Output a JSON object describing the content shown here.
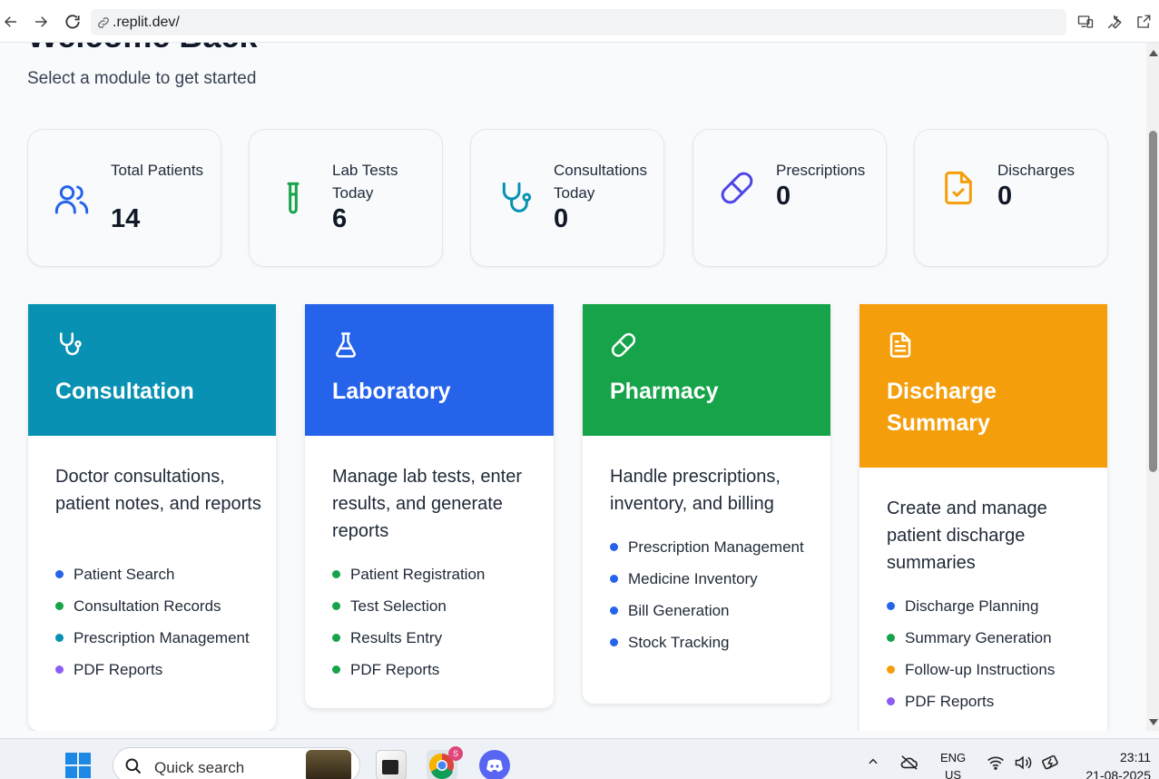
{
  "browser": {
    "url": ".replit.dev/"
  },
  "page": {
    "welcome": "Welcome Back",
    "subtitle": "Select a module to get started"
  },
  "stats": [
    {
      "label": "Total Patients",
      "value": "14",
      "icon": "users-icon",
      "color": "#2563eb"
    },
    {
      "label": "Lab Tests Today",
      "value": "6",
      "icon": "test-tube-icon",
      "color": "#16a34a"
    },
    {
      "label": "Consultations Today",
      "value": "0",
      "icon": "stethoscope-icon",
      "color": "#0891b2"
    },
    {
      "label": "Prescriptions",
      "value": "0",
      "icon": "pill-icon",
      "color": "#4f46e5"
    },
    {
      "label": "Discharges",
      "value": "0",
      "icon": "file-check-icon",
      "color": "#f59e0b"
    }
  ],
  "modules": [
    {
      "title": "Consultation",
      "color": "#0891b2",
      "description": "Doctor consultations, patient notes, and reports",
      "features": [
        {
          "label": "Patient Search",
          "dot": "#2563eb"
        },
        {
          "label": "Consultation Records",
          "dot": "#16a34a"
        },
        {
          "label": "Prescription Management",
          "dot": "#0891b2"
        },
        {
          "label": "PDF Reports",
          "dot": "#8b5cf6"
        }
      ]
    },
    {
      "title": "Laboratory",
      "color": "#2563eb",
      "description": "Manage lab tests, enter results, and generate reports",
      "features": [
        {
          "label": "Patient Registration",
          "dot": "#16a34a"
        },
        {
          "label": "Test Selection",
          "dot": "#16a34a"
        },
        {
          "label": "Results Entry",
          "dot": "#16a34a"
        },
        {
          "label": "PDF Reports",
          "dot": "#16a34a"
        }
      ]
    },
    {
      "title": "Pharmacy",
      "color": "#16a34a",
      "description": "Handle prescriptions, inventory, and billing",
      "features": [
        {
          "label": "Prescription Management",
          "dot": "#2563eb"
        },
        {
          "label": "Medicine Inventory",
          "dot": "#2563eb"
        },
        {
          "label": "Bill Generation",
          "dot": "#2563eb"
        },
        {
          "label": "Stock Tracking",
          "dot": "#2563eb"
        }
      ]
    },
    {
      "title": "Discharge Summary",
      "color": "#f59e0b",
      "description": "Create and manage patient discharge summaries",
      "features": [
        {
          "label": "Discharge Planning",
          "dot": "#2563eb"
        },
        {
          "label": "Summary Generation",
          "dot": "#16a34a"
        },
        {
          "label": "Follow-up Instructions",
          "dot": "#f59e0b"
        },
        {
          "label": "PDF Reports",
          "dot": "#8b5cf6"
        }
      ]
    }
  ],
  "taskbar": {
    "search_placeholder": "Quick search",
    "chrome_badge": "S",
    "lang_line1": "ENG",
    "lang_line2": "US",
    "time": "23:11",
    "date": "21-08-2025"
  }
}
